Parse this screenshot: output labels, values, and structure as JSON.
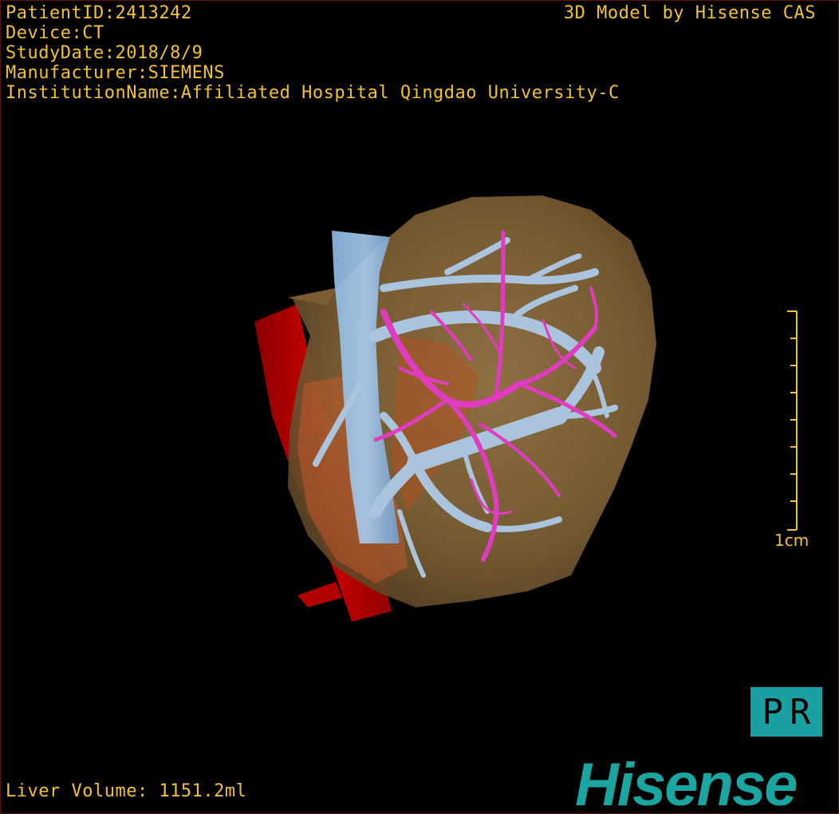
{
  "overlay": {
    "patient_id": "PatientID:2413242",
    "device": "Device:CT",
    "study_date": "StudyDate:2018/8/9",
    "manufacturer": "Manufacturer:SIEMENS",
    "institution": "InstitutionName:Affiliated Hospital Qingdao University-C",
    "watermark": "3D Model by Hisense CAS",
    "liver_volume": "Liver Volume: 1151.2ml"
  },
  "scale": {
    "label": "1cm"
  },
  "badge": {
    "label": "PR"
  },
  "brand": {
    "logo_text": "Hisense"
  },
  "colors": {
    "overlay_text": "#f2c230",
    "liver": "#8a6a3c",
    "portal_vein": "#a9c4dc",
    "hepatic_artery": "#e03cc0",
    "aorta": "#c00000",
    "ivc": "#6fa6e0",
    "brand": "#1aa5a0"
  },
  "icons": {
    "liver_model": "liver-3d-model",
    "scale": "scale-ruler-icon"
  }
}
